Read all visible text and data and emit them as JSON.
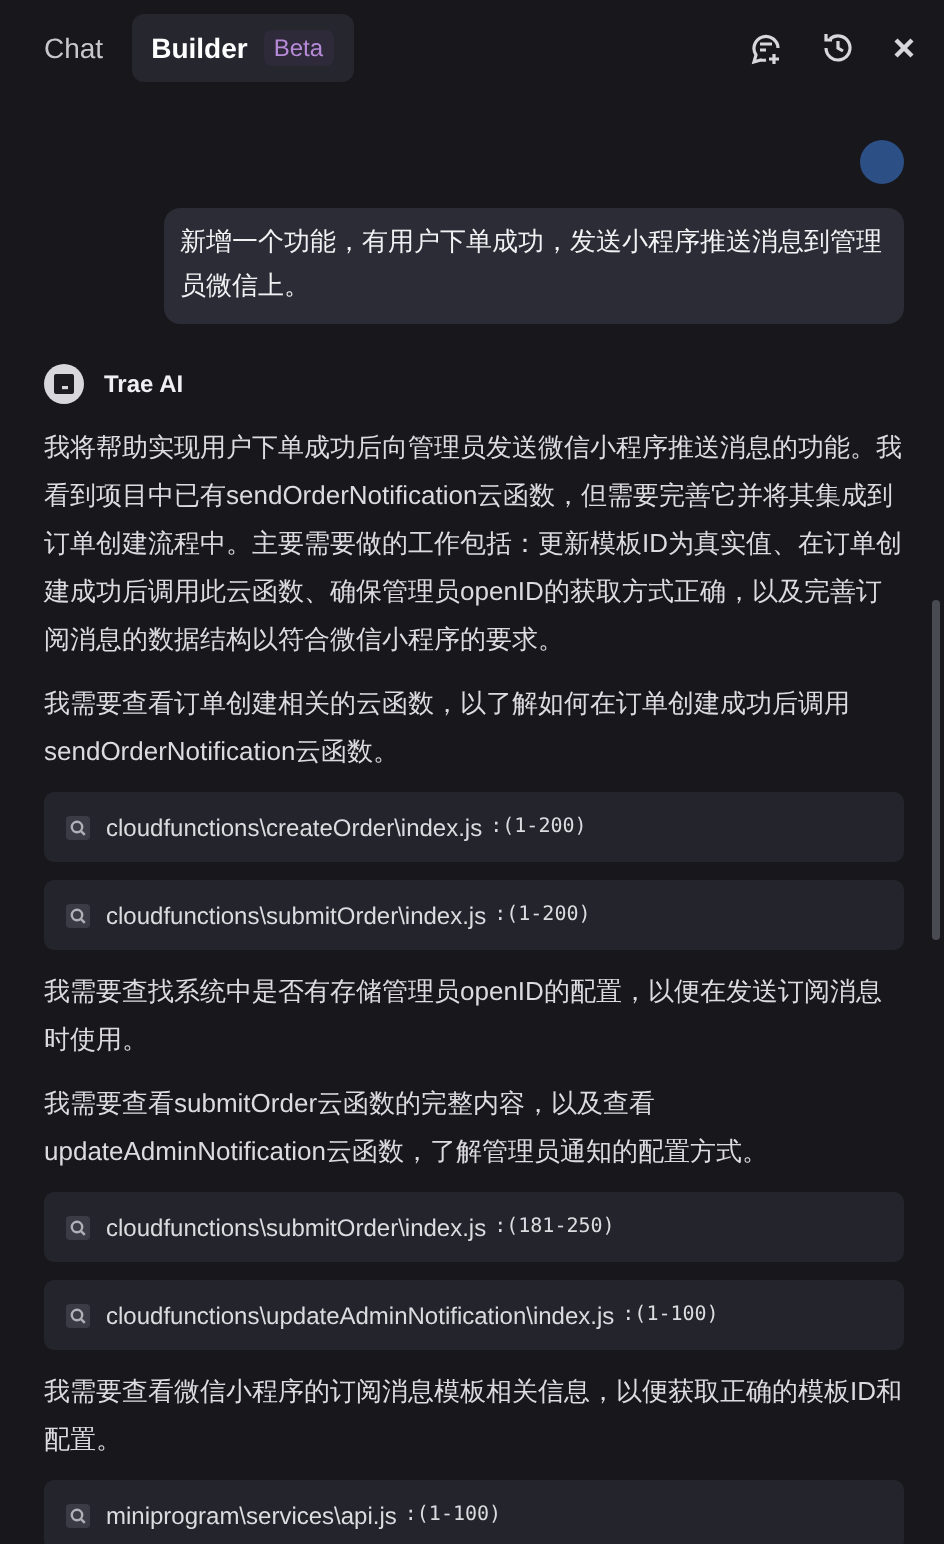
{
  "tabs": [
    {
      "label": "Chat",
      "selected": false
    },
    {
      "label": "Builder",
      "selected": true,
      "badge": "Beta"
    }
  ],
  "user_message": "新增一个功能，有用户下单成功，发送小程序推送消息到管理员微信上。",
  "assistant": {
    "name": "Trae AI"
  },
  "blocks": [
    {
      "kind": "text",
      "text": "我将帮助实现用户下单成功后向管理员发送微信小程序推送消息的功能。我看到项目中已有sendOrderNotification云函数，但需要完善它并将其集成到订单创建流程中。主要需要做的工作包括：更新模板ID为真实值、在订单创建成功后调用此云函数、确保管理员openID的获取方式正确，以及完善订阅消息的数据结构以符合微信小程序的要求。"
    },
    {
      "kind": "text",
      "text": "我需要查看订单创建相关的云函数，以了解如何在订单创建成功后调用sendOrderNotification云函数。"
    },
    {
      "kind": "file",
      "path": "cloudfunctions\\createOrder\\index.js",
      "range": ":(1-200)"
    },
    {
      "kind": "file",
      "path": "cloudfunctions\\submitOrder\\index.js",
      "range": ":(1-200)"
    },
    {
      "kind": "text",
      "text": "我需要查找系统中是否有存储管理员openID的配置，以便在发送订阅消息时使用。"
    },
    {
      "kind": "text",
      "text": "我需要查看submitOrder云函数的完整内容，以及查看updateAdminNotification云函数，了解管理员通知的配置方式。"
    },
    {
      "kind": "file",
      "path": "cloudfunctions\\submitOrder\\index.js",
      "range": ":(181-250)"
    },
    {
      "kind": "file",
      "path": "cloudfunctions\\updateAdminNotification\\index.js",
      "range": ":(1-100)"
    },
    {
      "kind": "text",
      "text": "我需要查看微信小程序的订阅消息模板相关信息，以便获取正确的模板ID和配置。"
    },
    {
      "kind": "file",
      "path": "miniprogram\\services\\api.js",
      "range": ":(1-100)"
    }
  ]
}
